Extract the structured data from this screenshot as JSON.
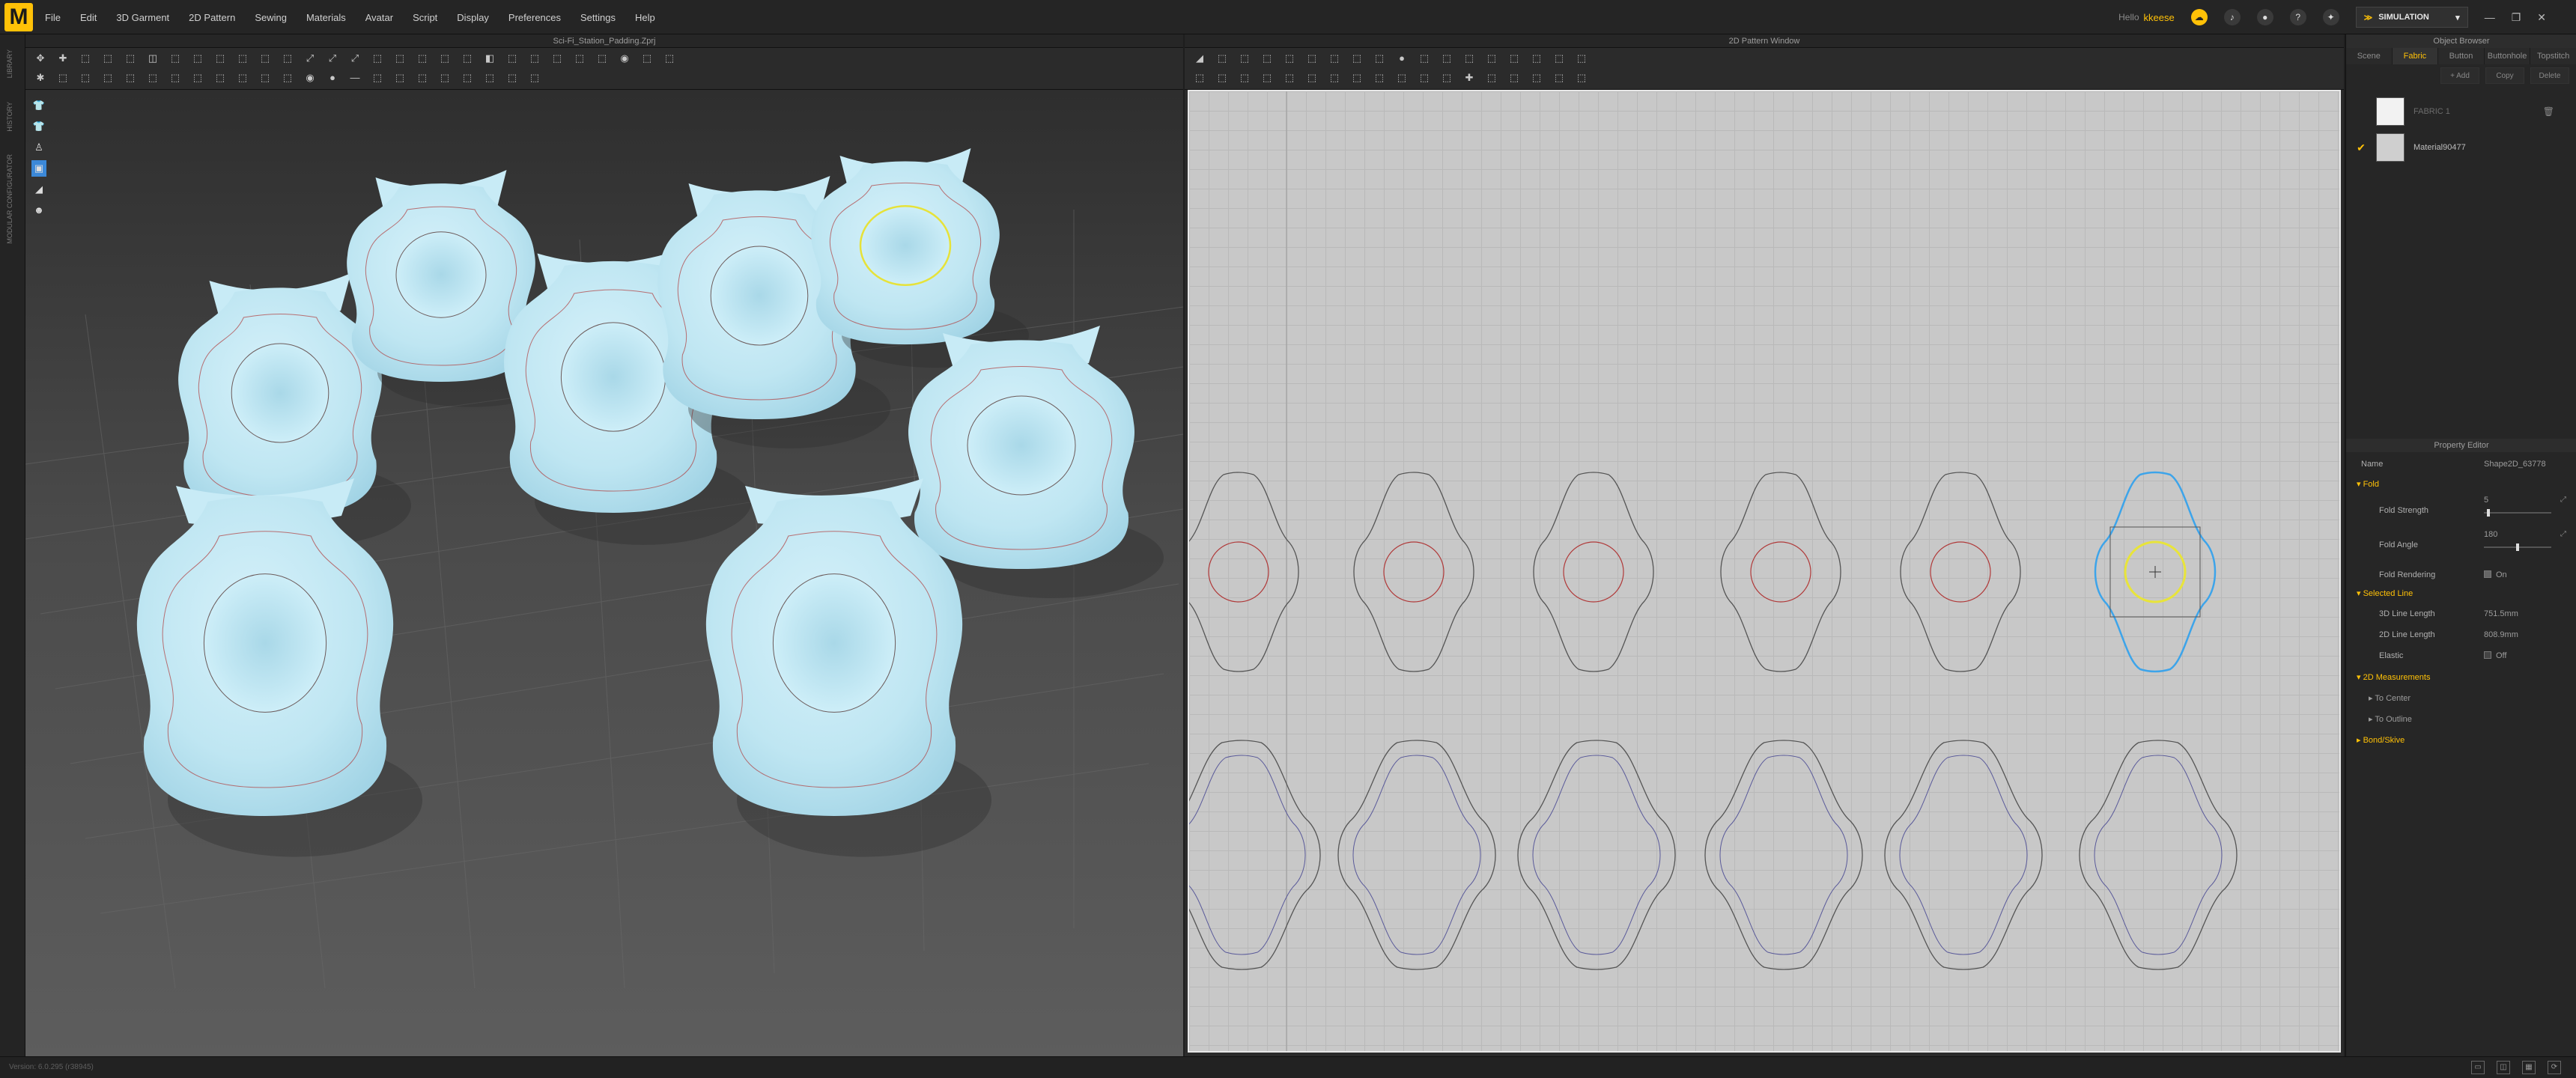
{
  "app": {
    "logo": "M"
  },
  "menu": [
    "File",
    "Edit",
    "3D Garment",
    "2D Pattern",
    "Sewing",
    "Materials",
    "Avatar",
    "Script",
    "Display",
    "Preferences",
    "Settings",
    "Help"
  ],
  "header_right": {
    "hello": "Hello",
    "user": "kkeese",
    "simulation": "SIMULATION"
  },
  "left_strip": {
    "tabs": [
      "LIBRARY",
      "HISTORY",
      "MODULAR CONFIGURATOR"
    ]
  },
  "view3d": {
    "title": "Sci-Fi_Station_Padding.Zprj",
    "toolbar_row1": [
      "✥",
      "✚",
      "⬚",
      "⬚",
      "⬚",
      "◫",
      "⬚",
      "⬚",
      "⬚",
      "⬚",
      "⬚",
      "⬚",
      "⤢",
      "⤢",
      "⤢",
      "⬚",
      "⬚",
      "⬚",
      "⬚",
      "⬚",
      "◧",
      "⬚",
      "⬚",
      "⬚",
      "⬚",
      "⬚",
      "◉",
      "⬚",
      "⬚"
    ],
    "toolbar_row2": [
      "✱",
      "⬚",
      "⬚",
      "⬚",
      "⬚",
      "⬚",
      "⬚",
      "⬚",
      "⬚",
      "⬚",
      "⬚",
      "⬚",
      "◉",
      "●",
      "—",
      "⬚",
      "⬚",
      "⬚",
      "⬚",
      "⬚",
      "⬚",
      "⬚",
      "⬚"
    ],
    "side_tools": [
      "shirt-icon",
      "shirt-icon",
      "avatar-icon",
      "fabric-icon",
      "ruler-icon",
      "person-icon"
    ]
  },
  "view2d": {
    "title": "2D Pattern Window",
    "toolbar_row1": [
      "◢",
      "⬚",
      "⬚",
      "⬚",
      "⬚",
      "⬚",
      "⬚",
      "⬚",
      "⬚",
      "●",
      "⬚",
      "⬚",
      "⬚",
      "⬚",
      "⬚",
      "⬚",
      "⬚",
      "⬚"
    ],
    "toolbar_row2": [
      "⬚",
      "⬚",
      "⬚",
      "⬚",
      "⬚",
      "⬚",
      "⬚",
      "⬚",
      "⬚",
      "⬚",
      "⬚",
      "⬚",
      "✚",
      "⬚",
      "⬚",
      "⬚",
      "⬚",
      "⬚"
    ]
  },
  "object_browser": {
    "title": "Object Browser",
    "tabs": [
      "Scene",
      "Fabric",
      "Button",
      "Buttonhole",
      "Topstitch"
    ],
    "active_tab": "Fabric",
    "actions": [
      "+ Add",
      "Copy",
      "Delete"
    ],
    "fabrics": [
      {
        "name": "FABRIC 1",
        "checked": false
      },
      {
        "name": "Material90477",
        "checked": true
      }
    ]
  },
  "property_editor": {
    "title": "Property Editor",
    "name_label": "Name",
    "name_value": "Shape2D_63778",
    "fold": "Fold",
    "fold_strength_label": "Fold Strength",
    "fold_strength_value": "5",
    "fold_strength_level": 0.05,
    "fold_angle_label": "Fold Angle",
    "fold_angle_value": "180",
    "fold_angle_level": 0.5,
    "fold_rendering_label": "Fold Rendering",
    "fold_rendering_value": "On",
    "selected_line": "Selected Line",
    "len3d_label": "3D Line Length",
    "len3d_value": "751.5mm",
    "len2d_label": "2D Line Length",
    "len2d_value": "808.9mm",
    "elastic_label": "Elastic",
    "elastic_value": "Off",
    "measurements": "2D Measurements",
    "to_center": "To Center",
    "to_outline": "To Outline",
    "bond_skive": "Bond/Skive"
  },
  "status": {
    "text": "Version: 6.0.295 (r38945)"
  },
  "colors": {
    "accent": "#ffc107",
    "fabric": "#bfe6f2",
    "selected": "#3da4ea",
    "seam": "#b03a3a"
  }
}
